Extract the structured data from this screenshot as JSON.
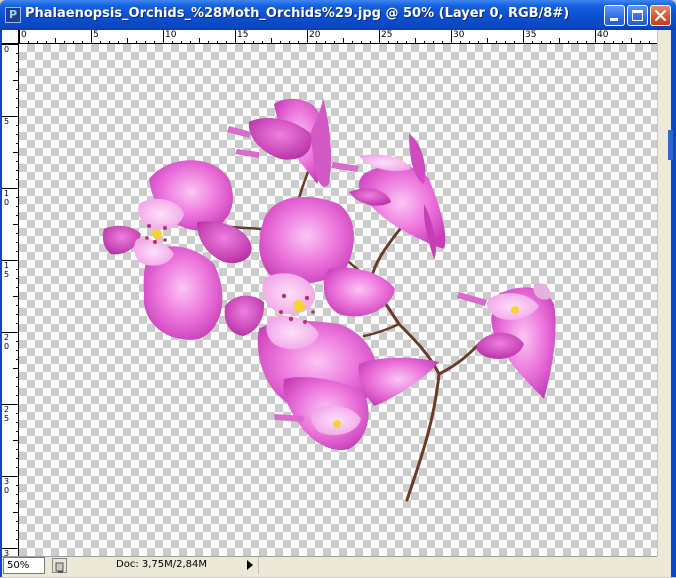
{
  "window": {
    "title": "Phalaenopsis_Orchids_%28Moth_Orchids%29.jpg @ 50% (Layer 0, RGB/8#)",
    "app_icon_letter": "P",
    "buttons": [
      "minimize",
      "maximize",
      "close"
    ]
  },
  "rulers": {
    "top_labels": [
      "0",
      "5",
      "10",
      "15",
      "20",
      "25",
      "30",
      "35",
      "40"
    ],
    "left_labels": [
      "0",
      "5",
      "10",
      "15",
      "20",
      "25",
      "30",
      "35"
    ]
  },
  "status": {
    "zoom": "50%",
    "doc_info": "Doc: 3,75M/2,84M"
  },
  "colors": {
    "title_bar": "#0a48c4",
    "petal": "#e05fd0",
    "petal_light": "#f5a6ee",
    "stem": "#6b3b2a"
  },
  "icons": {
    "app": "photoshop-doc-icon",
    "minimize": "minimize-icon",
    "maximize": "maximize-icon",
    "close": "close-icon",
    "status_menu": "status-menu-icon",
    "scroll_right": "arrow-right-icon"
  }
}
